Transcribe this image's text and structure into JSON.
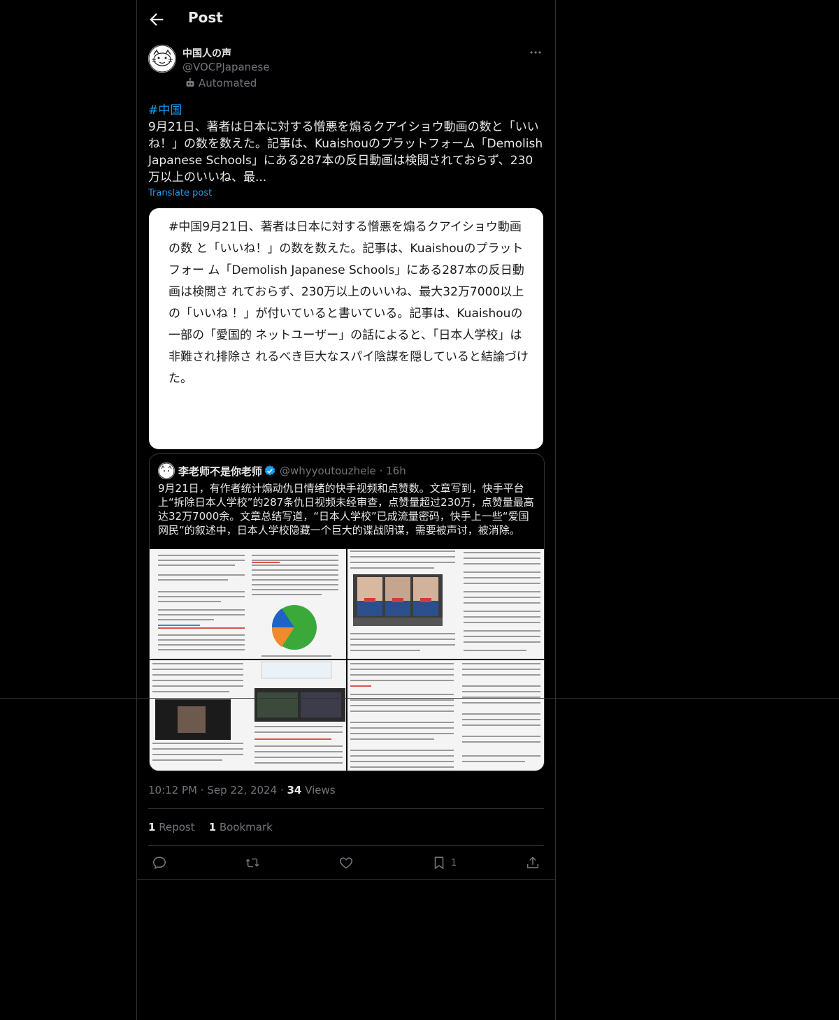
{
  "header": {
    "title": "Post"
  },
  "author": {
    "display_name": "中国人の声",
    "handle": "@VOCPJapanese",
    "label": "Automated"
  },
  "post": {
    "hashtag": "#中国",
    "text": "9月21日、著者は日本に対する憎悪を煽るクアイショウ動画の数と「いいね！」の数を数えた。記事は、Kuaishouのプラットフォーム「Demolish Japanese Schools」にある287本の反日動画は検閲されておらず、230万以上のいいね、最...",
    "translate_label": "Translate post",
    "media_text": "#中国9月21日、著者は日本に対する憎悪を煽るクアイショウ動画の数 と「いいね！」の数を数えた。記事は、Kuaishouのプラットフォー ム「Demolish Japanese Schools」にある287本の反日動画は検閲さ れておらず、230万以上のいいね、最大32万7000以上の「いいね ！」が付いていると書いている。記事は、Kuaishouの一部の「愛国的 ネットユーザー」の話によると、「日本人学校」は非難され排除さ れるべき巨大なスパイ陰謀を隠していると結論づけた。"
  },
  "quote": {
    "display_name": "李老师不是你老师",
    "handle": "@whyyoutouzhele",
    "time": "16h",
    "text": "9月21日，有作者统计煽动仇日情绪的快手视频和点赞数。文章写到，快手平台上“拆除日本人学校”的287条仇日视频未经审查，点赞量超过230万，点赞量最高达32万7000余。文章总结写道，“日本人学校”已成流量密码，快手上一些“爱国网民”的叙述中，日本人学校隐藏一个巨大的谍战阴谋，需要被声讨，被消除。"
  },
  "meta": {
    "time": "10:12 PM",
    "date": "Sep 22, 2024",
    "views_count": "34",
    "views_label": "Views"
  },
  "stats": {
    "reposts_count": "1",
    "reposts_label": "Repost",
    "bookmarks_count": "1",
    "bookmarks_label": "Bookmark"
  },
  "actions": {
    "bookmark_count": "1"
  },
  "colors": {
    "background": "#000000",
    "text": "#e7e9ea",
    "muted": "#71767b",
    "accent": "#1d9bf0",
    "border": "#2f3336"
  }
}
